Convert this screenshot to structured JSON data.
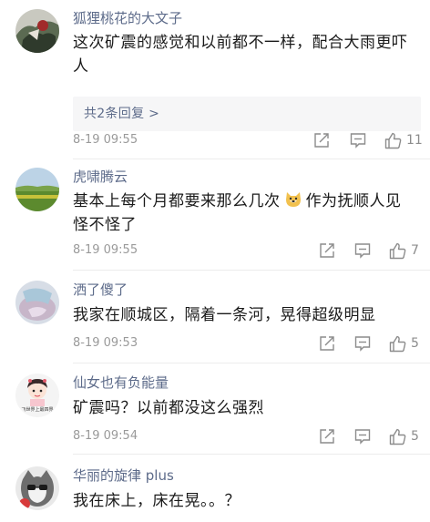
{
  "comments": [
    {
      "username": "狐狸桃花的大文子",
      "text": "这次矿震的感觉和以前都不一样，配合大雨更吓人",
      "replies_label": "共2条回复 >",
      "timestamp": "8-19 09:55",
      "likes": "11"
    },
    {
      "username": "虎啸腾云",
      "text_before": "基本上每个月都要来那么几次",
      "text_after": "作为抚顺人见怪不怪了",
      "timestamp": "8-19 09:55",
      "likes": "7"
    },
    {
      "username": "洒了傻了",
      "text": "我家在顺城区，隔着一条河，晃得超级明显",
      "timestamp": "8-19 09:53",
      "likes": "5"
    },
    {
      "username": "仙女也有负能量",
      "text": "矿震吗？以前都没这么强烈",
      "timestamp": "8-19 09:54",
      "likes": "5"
    },
    {
      "username": "华丽的旋律 plus",
      "text": "我在床上，床在晃。。？",
      "timestamp": "",
      "likes": ""
    }
  ],
  "avatar_text": {
    "fairy_caption": "飞世界上最四界"
  },
  "icons": {
    "share": "share-icon",
    "comment": "comment-icon",
    "like": "like-icon",
    "emoji": "dog-face-emoji"
  },
  "colors": {
    "username": "#5d6b8a",
    "body": "#1a1a1a",
    "meta": "#9a9a9a",
    "reply_bg": "#f6f6f7"
  }
}
